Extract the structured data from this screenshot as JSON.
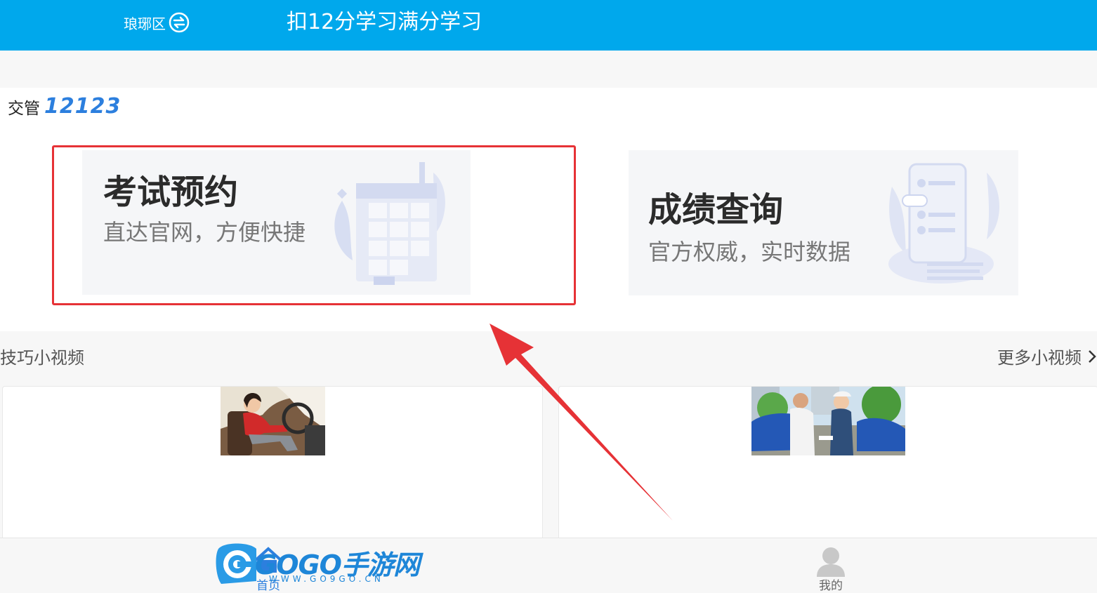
{
  "header": {
    "region": "琅琊区",
    "title": "扣12分学习满分学习"
  },
  "brand": {
    "text": "交管",
    "number": "12123"
  },
  "services": [
    {
      "title": "考试预约",
      "subtitle": "直达官网，方便快捷"
    },
    {
      "title": "成绩查询",
      "subtitle": "官方权威，实时数据"
    }
  ],
  "videos": {
    "section_title": "技巧小视频",
    "more_label": "更多小视频"
  },
  "bottom_nav": {
    "home_label": "首页",
    "mine_label": "我的"
  },
  "watermark": {
    "brand": "GOGO手游网",
    "url": "WWW.GO9GO.CN"
  },
  "colors": {
    "header": "#00a8ec",
    "highlight": "#e63236",
    "brand_blue": "#2c7fde"
  }
}
